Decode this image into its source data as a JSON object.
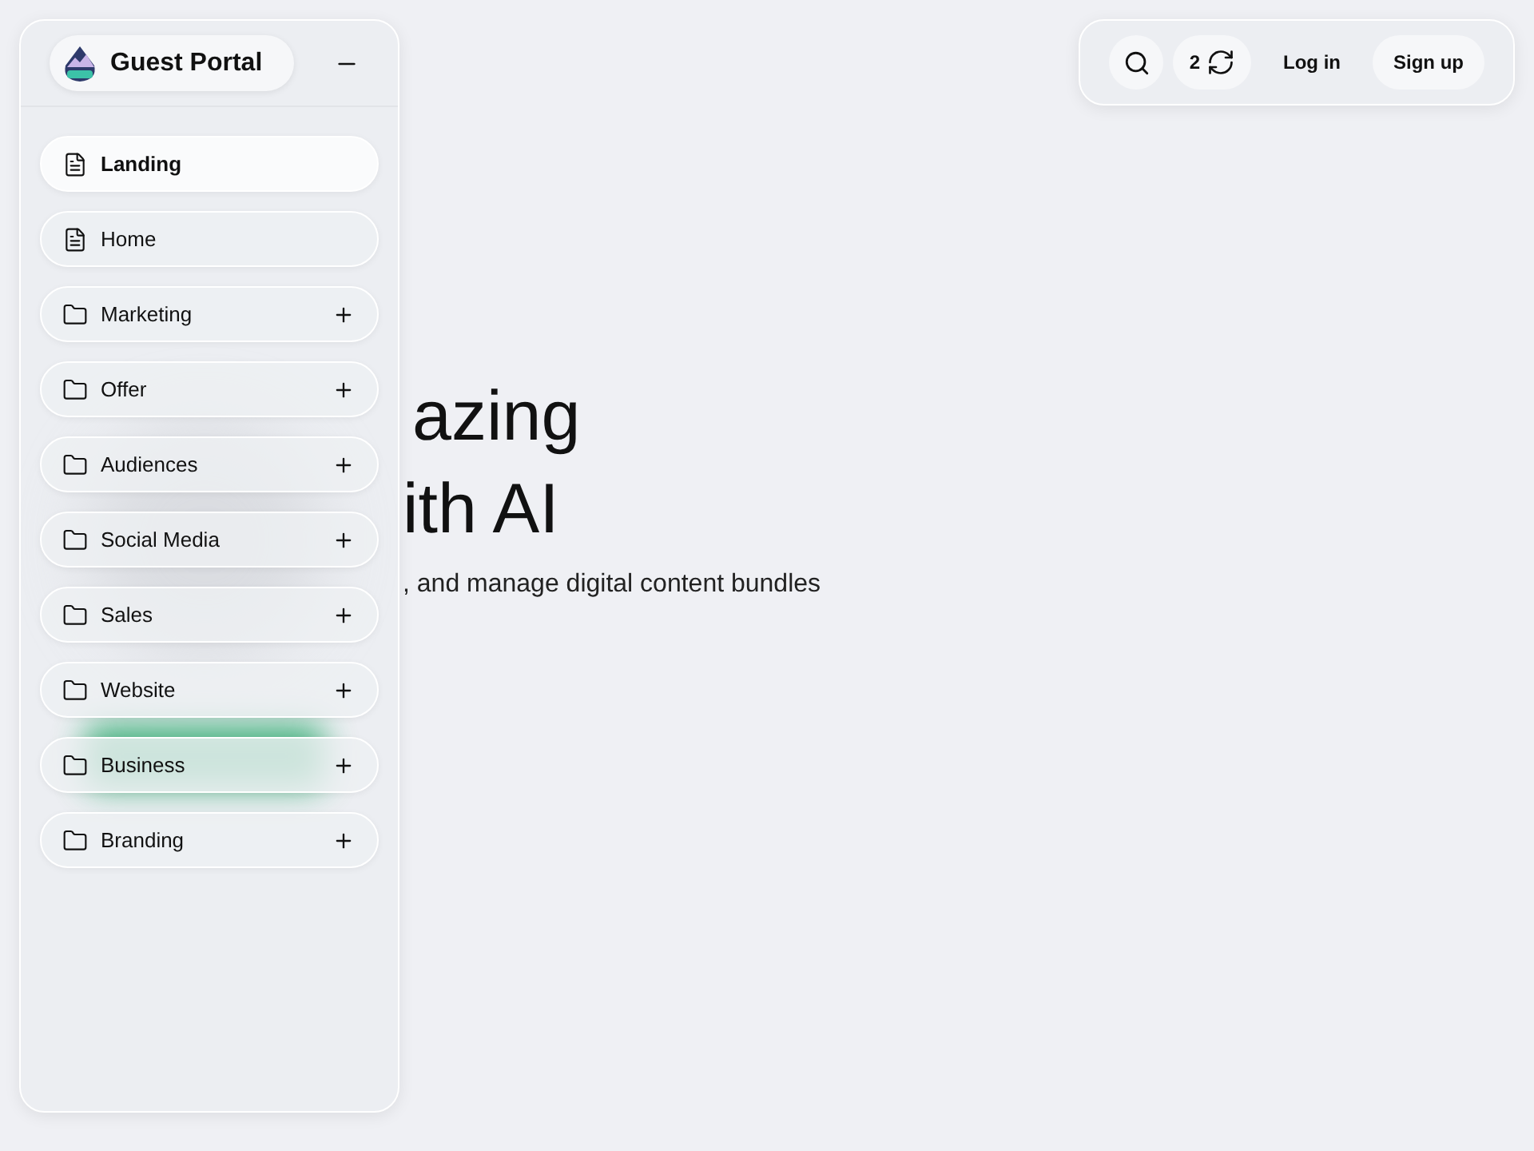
{
  "sidebar": {
    "title": "Guest Portal",
    "items": [
      {
        "label": "Landing",
        "kind": "page",
        "selected": true
      },
      {
        "label": "Home",
        "kind": "page",
        "selected": false
      },
      {
        "label": "Marketing",
        "kind": "folder",
        "selected": false,
        "expanded": false
      },
      {
        "label": "Offer",
        "kind": "folder",
        "selected": false,
        "expanded": false
      },
      {
        "label": "Audiences",
        "kind": "folder",
        "selected": false,
        "expanded": false
      },
      {
        "label": "Social Media",
        "kind": "folder",
        "selected": false,
        "expanded": false
      },
      {
        "label": "Sales",
        "kind": "folder",
        "selected": false,
        "expanded": false
      },
      {
        "label": "Website",
        "kind": "folder",
        "selected": false,
        "expanded": false
      },
      {
        "label": "Business",
        "kind": "folder",
        "selected": false,
        "expanded": false
      },
      {
        "label": "Branding",
        "kind": "folder",
        "selected": false,
        "expanded": false
      }
    ]
  },
  "header": {
    "count": "2",
    "login": "Log in",
    "signup": "Sign up"
  },
  "hero": {
    "line_1": "azing",
    "line_2": "ith AI",
    "subtitle": ", and manage digital content bundles"
  }
}
